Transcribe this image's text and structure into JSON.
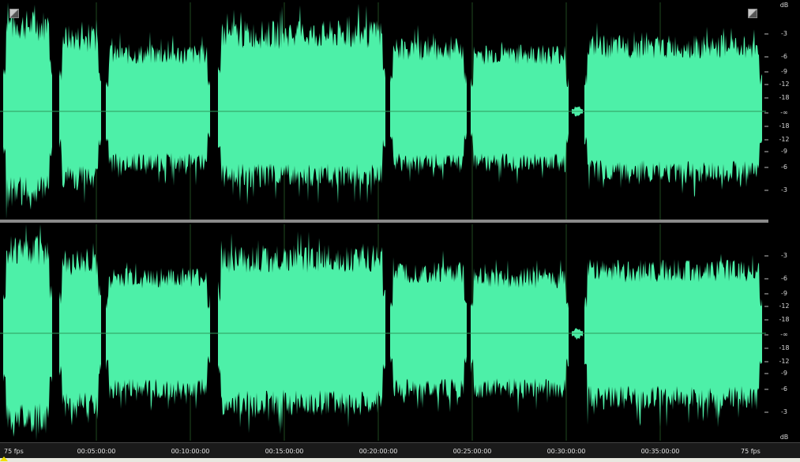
{
  "app": {
    "view": "waveform editor",
    "accent_color": "#4df0a8",
    "background_color": "#000000"
  },
  "channels": [
    {
      "id": "left",
      "db_header": "dB",
      "db_scale": [
        "-3",
        "-6",
        "-9",
        "-12",
        "-18",
        "-∞",
        "-18",
        "-12",
        "-9",
        "-6",
        "-3"
      ]
    },
    {
      "id": "right",
      "db_header": "dB",
      "db_scale": [
        "-3",
        "-6",
        "-9",
        "-12",
        "-18",
        "-∞",
        "-18",
        "-12",
        "-9",
        "-6",
        "-3"
      ]
    }
  ],
  "ruler": {
    "fps_left": "75 fps",
    "fps_right": "75 fps",
    "ticks": [
      "00:05:00:00",
      "00:10:00:00",
      "00:15:00:00",
      "00:20:00:00",
      "00:25:00:00",
      "00:30:00:00",
      "00:35:00:00"
    ]
  },
  "icons": {
    "top_left": "zoom-corner-icon",
    "top_right": "zoom-corner-icon",
    "cursor": "playhead-marker-icon"
  }
}
